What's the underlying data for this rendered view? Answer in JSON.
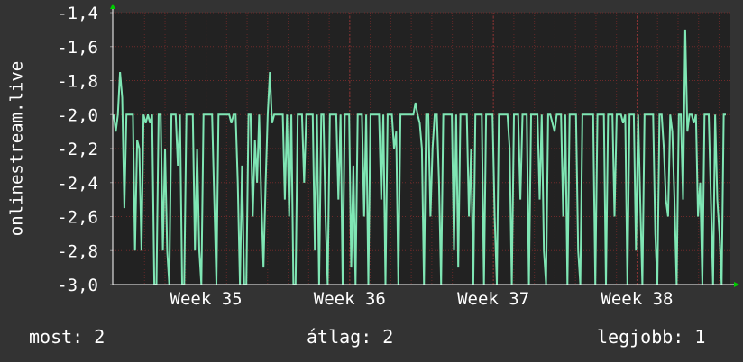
{
  "chart_data": {
    "type": "line",
    "ylabel": "onlinestream.live",
    "ylim": [
      -3.0,
      -1.4
    ],
    "y_ticks": [
      -3.0,
      -2.8,
      -2.6,
      -2.4,
      -2.2,
      -2.0,
      -1.8,
      -1.6,
      -1.4
    ],
    "y_tick_labels": [
      "-3,0",
      "-2,8",
      "-2,6",
      "-2,4",
      "-2,2",
      "-2,0",
      "-1,8",
      "-1,6",
      "-1,4"
    ],
    "x_ticks": [
      {
        "label": "Week 35",
        "pos": 1.0
      },
      {
        "label": "Week 36",
        "pos": 2.0
      },
      {
        "label": "Week 37",
        "pos": 3.0
      },
      {
        "label": "Week 38",
        "pos": 4.0
      }
    ],
    "xlim": [
      0.35,
      4.65
    ],
    "grid": true,
    "colors": {
      "background": "#333333",
      "plot_area": "#222222",
      "line": "#7fe6b4",
      "grid": "#6e2a2a",
      "arrow": "#00cc00"
    },
    "series": [
      {
        "values": [
          -2.0,
          -2.1,
          -2.0,
          -1.75,
          -1.9,
          -2.55,
          -2.0,
          -2.0,
          -2.0,
          -2.0,
          -2.8,
          -2.15,
          -2.2,
          -2.8,
          -2.0,
          -2.05,
          -2.0,
          -2.05,
          -2.0,
          -3.0,
          -3.0,
          -2.0,
          -2.0,
          -2.8,
          -2.2,
          -2.8,
          -3.0,
          -2.0,
          -2.0,
          -2.0,
          -2.3,
          -2.0,
          -3.0,
          -3.0,
          -2.0,
          -2.0,
          -2.0,
          -2.0,
          -2.8,
          -2.2,
          -2.8,
          -3.0,
          -2.0,
          -2.0,
          -2.0,
          -2.0,
          -2.0,
          -2.5,
          -3.0,
          -2.0,
          -2.0,
          -2.0,
          -2.0,
          -2.0,
          -2.0,
          -2.05,
          -2.0,
          -2.0,
          -2.4,
          -3.0,
          -2.3,
          -3.0,
          -3.0,
          -2.0,
          -2.0,
          -2.6,
          -2.15,
          -2.4,
          -2.0,
          -2.5,
          -2.9,
          -2.4,
          -2.0,
          -1.75,
          -2.05,
          -2.0,
          -2.0,
          -2.0,
          -2.0,
          -2.0,
          -2.5,
          -2.0,
          -2.6,
          -2.0,
          -3.0,
          -3.0,
          -2.0,
          -2.0,
          -2.0,
          -2.4,
          -2.0,
          -2.0,
          -2.0,
          -2.0,
          -2.8,
          -2.0,
          -3.0,
          -2.0,
          -2.0,
          -2.6,
          -3.0,
          -2.0,
          -2.0,
          -2.0,
          -2.0,
          -2.5,
          -2.0,
          -3.0,
          -2.0,
          -2.0,
          -2.0,
          -2.9,
          -2.3,
          -3.0,
          -2.0,
          -2.0,
          -2.0,
          -2.6,
          -2.0,
          -3.0,
          -2.0,
          -2.0,
          -2.0,
          -2.0,
          -2.0,
          -2.5,
          -2.0,
          -3.0,
          -2.0,
          -2.0,
          -2.0,
          -2.2,
          -2.1,
          -3.0,
          -2.0,
          -2.0,
          -2.0,
          -2.0,
          -2.0,
          -2.0,
          -2.0,
          -1.93,
          -2.0,
          -2.05,
          -2.2,
          -3.0,
          -2.0,
          -2.0,
          -2.6,
          -2.2,
          -2.0,
          -2.0,
          -2.4,
          -3.0,
          -2.0,
          -2.0,
          -2.0,
          -2.0,
          -2.0,
          -2.8,
          -2.0,
          -2.9,
          -2.0,
          -2.0,
          -2.0,
          -2.0,
          -2.6,
          -2.2,
          -3.0,
          -2.0,
          -2.0,
          -2.0,
          -2.0,
          -3.0,
          -2.0,
          -2.0,
          -2.0,
          -2.0,
          -2.6,
          -3.0,
          -2.0,
          -2.0,
          -2.0,
          -2.0,
          -2.0,
          -2.2,
          -3.0,
          -2.0,
          -2.0,
          -2.0,
          -2.5,
          -2.0,
          -2.0,
          -2.0,
          -3.0,
          -2.0,
          -2.0,
          -2.0,
          -2.0,
          -2.5,
          -2.0,
          -2.8,
          -3.0,
          -2.0,
          -2.0,
          -2.05,
          -2.1,
          -2.0,
          -2.0,
          -2.0,
          -2.6,
          -2.0,
          -3.0,
          -2.0,
          -2.0,
          -2.0,
          -2.0,
          -2.8,
          -3.0,
          -2.0,
          -2.0,
          -2.0,
          -2.0,
          -2.0,
          -2.0,
          -3.0,
          -2.0,
          -2.0,
          -2.0,
          -2.0,
          -3.0,
          -2.0,
          -2.0,
          -2.0,
          -2.6,
          -2.0,
          -2.0,
          -2.0,
          -2.05,
          -2.0,
          -3.0,
          -2.0,
          -2.0,
          -2.0,
          -2.8,
          -2.0,
          -2.5,
          -3.0,
          -2.0,
          -2.0,
          -2.0,
          -2.0,
          -2.0,
          -2.7,
          -3.0,
          -2.0,
          -2.0,
          -2.2,
          -2.5,
          -2.6,
          -2.0,
          -2.1,
          -2.5,
          -3.0,
          -2.0,
          -2.0,
          -2.5,
          -1.5,
          -2.1,
          -2.0,
          -2.0,
          -2.05,
          -2.0,
          -2.6,
          -2.4,
          -3.0,
          -2.0,
          -2.0,
          -2.0,
          -2.5,
          -3.0,
          -2.0,
          -2.5,
          -2.7,
          -3.0,
          -2.0,
          -2.0
        ]
      }
    ]
  },
  "footer": {
    "current_label": "most: 2",
    "average_label": "átlag: 2",
    "best_label": "legjobb: 1"
  }
}
